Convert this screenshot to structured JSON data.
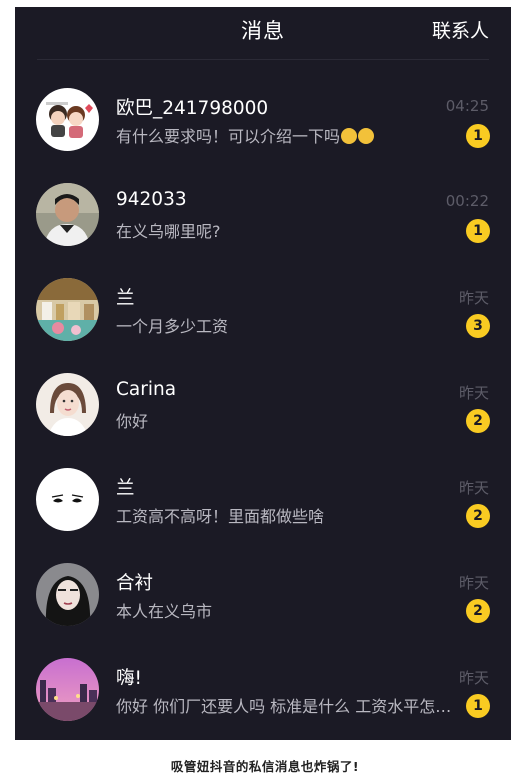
{
  "header": {
    "title": "消息",
    "contacts_label": "联系人"
  },
  "conversations": [
    {
      "name": "欧巴_241798000",
      "preview": "有什么要求吗！可以介绍一下吗",
      "time": "04:25",
      "unread": "1",
      "avatar_icon": "cartoon-couple-avatar"
    },
    {
      "name": "942033",
      "preview": "在义乌哪里呢?",
      "time": "00:22",
      "unread": "1",
      "avatar_icon": "man-photo-avatar"
    },
    {
      "name": "兰",
      "preview": "一个月多少工资",
      "time": "昨天",
      "unread": "3",
      "avatar_icon": "shop-photo-avatar"
    },
    {
      "name": "Carina",
      "preview": "你好",
      "time": "昨天",
      "unread": "2",
      "avatar_icon": "woman-photo-avatar"
    },
    {
      "name": "兰",
      "preview": "工资高不高呀！里面都做些啥",
      "time": "昨天",
      "unread": "2",
      "avatar_icon": "eyes-drawing-avatar"
    },
    {
      "name": "合衬",
      "preview": "本人在义乌市",
      "time": "昨天",
      "unread": "2",
      "avatar_icon": "girl-photo-avatar"
    },
    {
      "name": "嗨!",
      "preview": "你好 你们厂还要人吗 标准是什么 工资水平怎么样",
      "time": "昨天",
      "unread": "1",
      "avatar_icon": "sunset-street-avatar"
    }
  ],
  "caption": "吸管妞抖音的私信消息也炸锅了!",
  "colors": {
    "background": "#1b1a25",
    "badge": "#f9cb22",
    "time": "#5d5c68",
    "preview": "#b9b8c1"
  }
}
